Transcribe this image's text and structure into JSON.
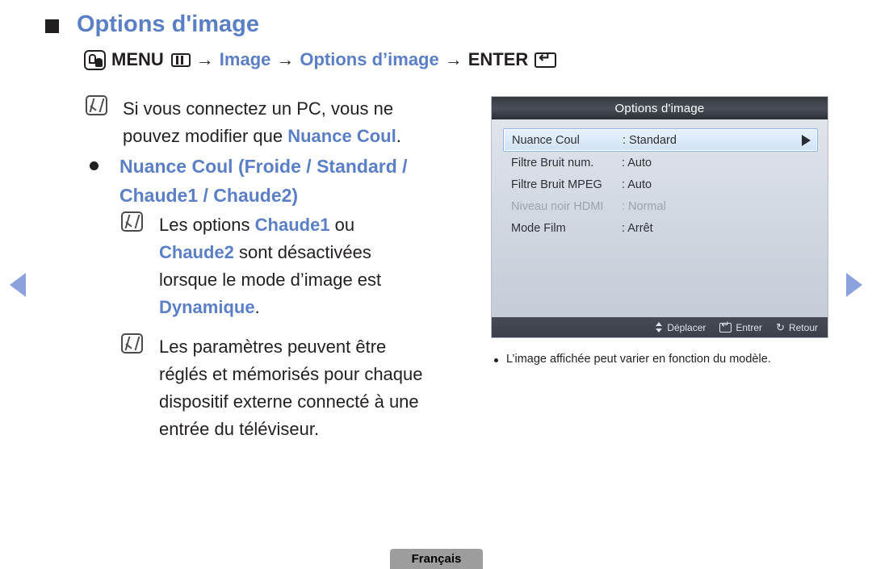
{
  "heading": {
    "title": "Options d'image",
    "bullet_icon": "black-square-bullet"
  },
  "menu_path": {
    "hand_icon": "hand-press-icon",
    "menu_label": "MENU",
    "menu_glyph_icon": "menu-grid-icon",
    "arrow1": "→",
    "item1": "Image",
    "arrow2": "→",
    "item2": "Options d’image",
    "arrow3": "→",
    "enter_label": "ENTER",
    "enter_glyph_icon": "enter-key-icon"
  },
  "notes": {
    "note1": {
      "icon": "note-pencil-icon",
      "line1_a": "Si vous connectez un PC, vous ne",
      "line2_a": "pouvez modifier que ",
      "line2_b": "Nuance Coul",
      "line2_c": "."
    },
    "bullet": {
      "icon": "round-bullet",
      "text_line1": "Nuance Coul (Froide / Standard /",
      "text_line2": "Chaude1 / Chaude2)"
    },
    "note2": {
      "icon": "note-pencil-icon",
      "seg1": "Les options ",
      "seg2": "Chaude1",
      "seg3": " ou",
      "seg4": "Chaude2",
      "seg5": " sont désactivées",
      "seg6": "lorsque le mode d’image est",
      "seg7": "Dynamique",
      "seg8": "."
    },
    "note3": {
      "icon": "note-pencil-icon",
      "line1": "Les paramètres peuvent être",
      "line2": "réglés et mémorisés pour chaque",
      "line3": "dispositif externe connecté à une",
      "line4": "entrée du téléviseur."
    }
  },
  "nav": {
    "left_icon": "triangle-left-icon",
    "right_icon": "triangle-right-icon"
  },
  "tv_menu": {
    "title": "Options d'image",
    "rows": [
      {
        "label": "Nuance Coul",
        "value": ": Standard",
        "selected": true,
        "disabled": false,
        "arrow_icon": "triangle-right-icon"
      },
      {
        "label": "Filtre Bruit num.",
        "value": ": Auto",
        "selected": false,
        "disabled": false
      },
      {
        "label": "Filtre Bruit MPEG",
        "value": ": Auto",
        "selected": false,
        "disabled": false
      },
      {
        "label": "Niveau noir HDMI",
        "value": ": Normal",
        "selected": false,
        "disabled": true
      },
      {
        "label": "Mode Film",
        "value": ": Arrêt",
        "selected": false,
        "disabled": false
      }
    ],
    "hints": [
      {
        "icon": "up-down-arrow-icon",
        "label": "Déplacer"
      },
      {
        "icon": "enter-key-icon",
        "label": "Entrer"
      },
      {
        "icon": "return-arrow-icon",
        "label": "Retour"
      }
    ],
    "colors": {
      "accent_blue": "#5b7fc7",
      "selected_row_border": "#8fb7e0",
      "titlebar_dark": "#34383f"
    }
  },
  "tv_caption": {
    "bullet_icon": "round-bullet",
    "text": "L’image affichée peut varier en fonction du modèle."
  },
  "footer": {
    "language": "Français"
  }
}
